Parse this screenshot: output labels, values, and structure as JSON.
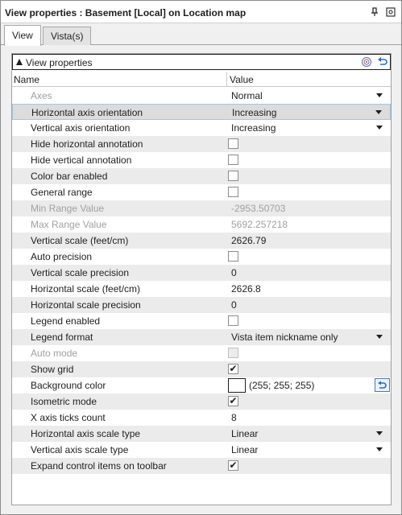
{
  "window": {
    "title": "View properties : Basement [Local] on Location map",
    "pin_icon": "pin-icon",
    "menu_icon": "options-icon"
  },
  "tabs": [
    {
      "label": "View",
      "active": true
    },
    {
      "label": "Vista(s)",
      "active": false
    }
  ],
  "section": {
    "title": "View properties",
    "collapse_icon": "collapse-triangle-icon",
    "icons": [
      "radar-icon",
      "undo-icon"
    ]
  },
  "grid": {
    "col_name": "Name",
    "col_value": "Value",
    "rows": [
      {
        "name": "Axes",
        "type": "dropdown",
        "value": "Normal",
        "disabled_name": true
      },
      {
        "name": "Horizontal axis orientation",
        "type": "dropdown",
        "value": "Increasing",
        "selected": true
      },
      {
        "name": "Vertical axis orientation",
        "type": "dropdown",
        "value": "Increasing"
      },
      {
        "name": "Hide horizontal annotation",
        "type": "checkbox",
        "checked": false
      },
      {
        "name": "Hide vertical annotation",
        "type": "checkbox",
        "checked": false
      },
      {
        "name": "Color bar enabled",
        "type": "checkbox",
        "checked": false
      },
      {
        "name": "General range",
        "type": "checkbox",
        "checked": false
      },
      {
        "name": "Min Range Value",
        "type": "text",
        "value": "-2953.50703",
        "disabled": true
      },
      {
        "name": "Max Range Value",
        "type": "text",
        "value": "5692.257218",
        "disabled": true
      },
      {
        "name": "Vertical scale (feet/cm)",
        "type": "text",
        "value": "2626.79"
      },
      {
        "name": "Auto precision",
        "type": "checkbox",
        "checked": false
      },
      {
        "name": "Vertical scale precision",
        "type": "text",
        "value": "0"
      },
      {
        "name": "Horizontal scale (feet/cm)",
        "type": "text",
        "value": "2626.8"
      },
      {
        "name": "Horizontal scale precision",
        "type": "text",
        "value": "0"
      },
      {
        "name": "Legend enabled",
        "type": "checkbox",
        "checked": false
      },
      {
        "name": "Legend format",
        "type": "dropdown",
        "value": "Vista item nickname only"
      },
      {
        "name": "Auto mode",
        "type": "checkbox",
        "checked": false,
        "disabled": true
      },
      {
        "name": "Show grid",
        "type": "checkbox",
        "checked": true
      },
      {
        "name": "Background color",
        "type": "color",
        "value": "(255; 255; 255)",
        "color": "#ffffff"
      },
      {
        "name": "Isometric mode",
        "type": "checkbox",
        "checked": true
      },
      {
        "name": "X axis ticks count",
        "type": "text",
        "value": "8"
      },
      {
        "name": "Horizontal axis scale type",
        "type": "dropdown",
        "value": "Linear"
      },
      {
        "name": "Vertical axis scale type",
        "type": "dropdown",
        "value": "Linear"
      },
      {
        "name": "Expand control items on toolbar",
        "type": "checkbox",
        "checked": true
      }
    ]
  },
  "colors": {
    "accent": "#3c7fc0",
    "row_alt": "#ebebeb",
    "disabled_text": "#a0a0a0"
  }
}
